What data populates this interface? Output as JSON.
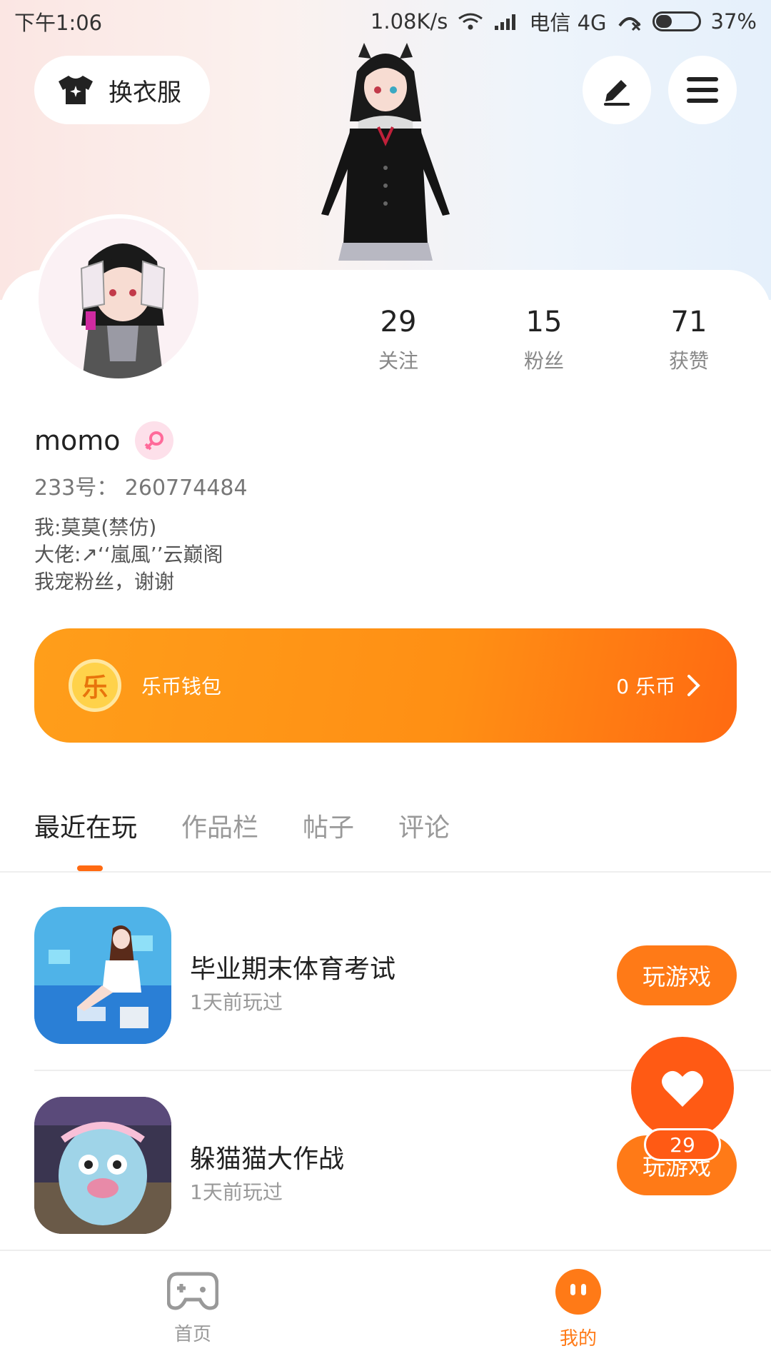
{
  "status_bar": {
    "time": "下午1:06",
    "network_speed": "1.08K/s",
    "carrier": "电信 4G",
    "battery": "37%",
    "battery_level": 0.37
  },
  "header": {
    "outfit_label": "换衣服"
  },
  "profile": {
    "stats": [
      {
        "value": "29",
        "label": "关注"
      },
      {
        "value": "15",
        "label": "粉丝"
      },
      {
        "value": "71",
        "label": "获赞"
      }
    ],
    "username": "momo",
    "uid": "233号：  260774484",
    "bio": [
      "我:莫莫(禁仿)",
      "大佬:↗‘‘嵐風’’云巅阁",
      "我宠粉丝，谢谢"
    ]
  },
  "wallet": {
    "coin_glyph": "乐",
    "label": "乐币钱包",
    "amount": "0 乐币"
  },
  "tabs": [
    {
      "label": "最近在玩",
      "active": true
    },
    {
      "label": "作品栏",
      "active": false
    },
    {
      "label": "帖子",
      "active": false
    },
    {
      "label": "评论",
      "active": false
    }
  ],
  "games": [
    {
      "title": "毕业期末体育考试",
      "subtitle": "1天前玩过",
      "button": "玩游戏"
    },
    {
      "title": "躲猫猫大作战",
      "subtitle": "1天前玩过",
      "button": "玩游戏"
    }
  ],
  "like_fab": {
    "count": "29"
  },
  "bottom_nav": [
    {
      "label": "首页",
      "icon": "gamepad-icon",
      "active": false
    },
    {
      "label": "我的",
      "icon": "profile-face-icon",
      "active": true
    }
  ],
  "colors": {
    "accent": "#ff7a17",
    "accent_dark": "#ff5a14",
    "muted": "#999999"
  }
}
